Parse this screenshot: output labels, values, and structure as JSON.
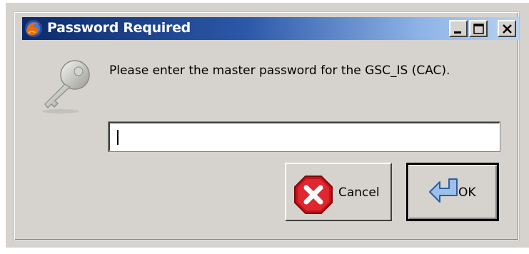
{
  "window": {
    "title": "Password Required",
    "app_icon": "firefox-icon",
    "controls": [
      "minimize-icon",
      "maximize-icon",
      "close-icon"
    ]
  },
  "dialog": {
    "icon": "key-icon",
    "message": "Please enter the master password for the GSC_IS (CAC).",
    "password_value": ""
  },
  "buttons": {
    "cancel_label": "Cancel",
    "cancel_icon": "cancel-icon",
    "ok_label": "OK",
    "ok_icon": "enter-arrow-icon"
  }
}
